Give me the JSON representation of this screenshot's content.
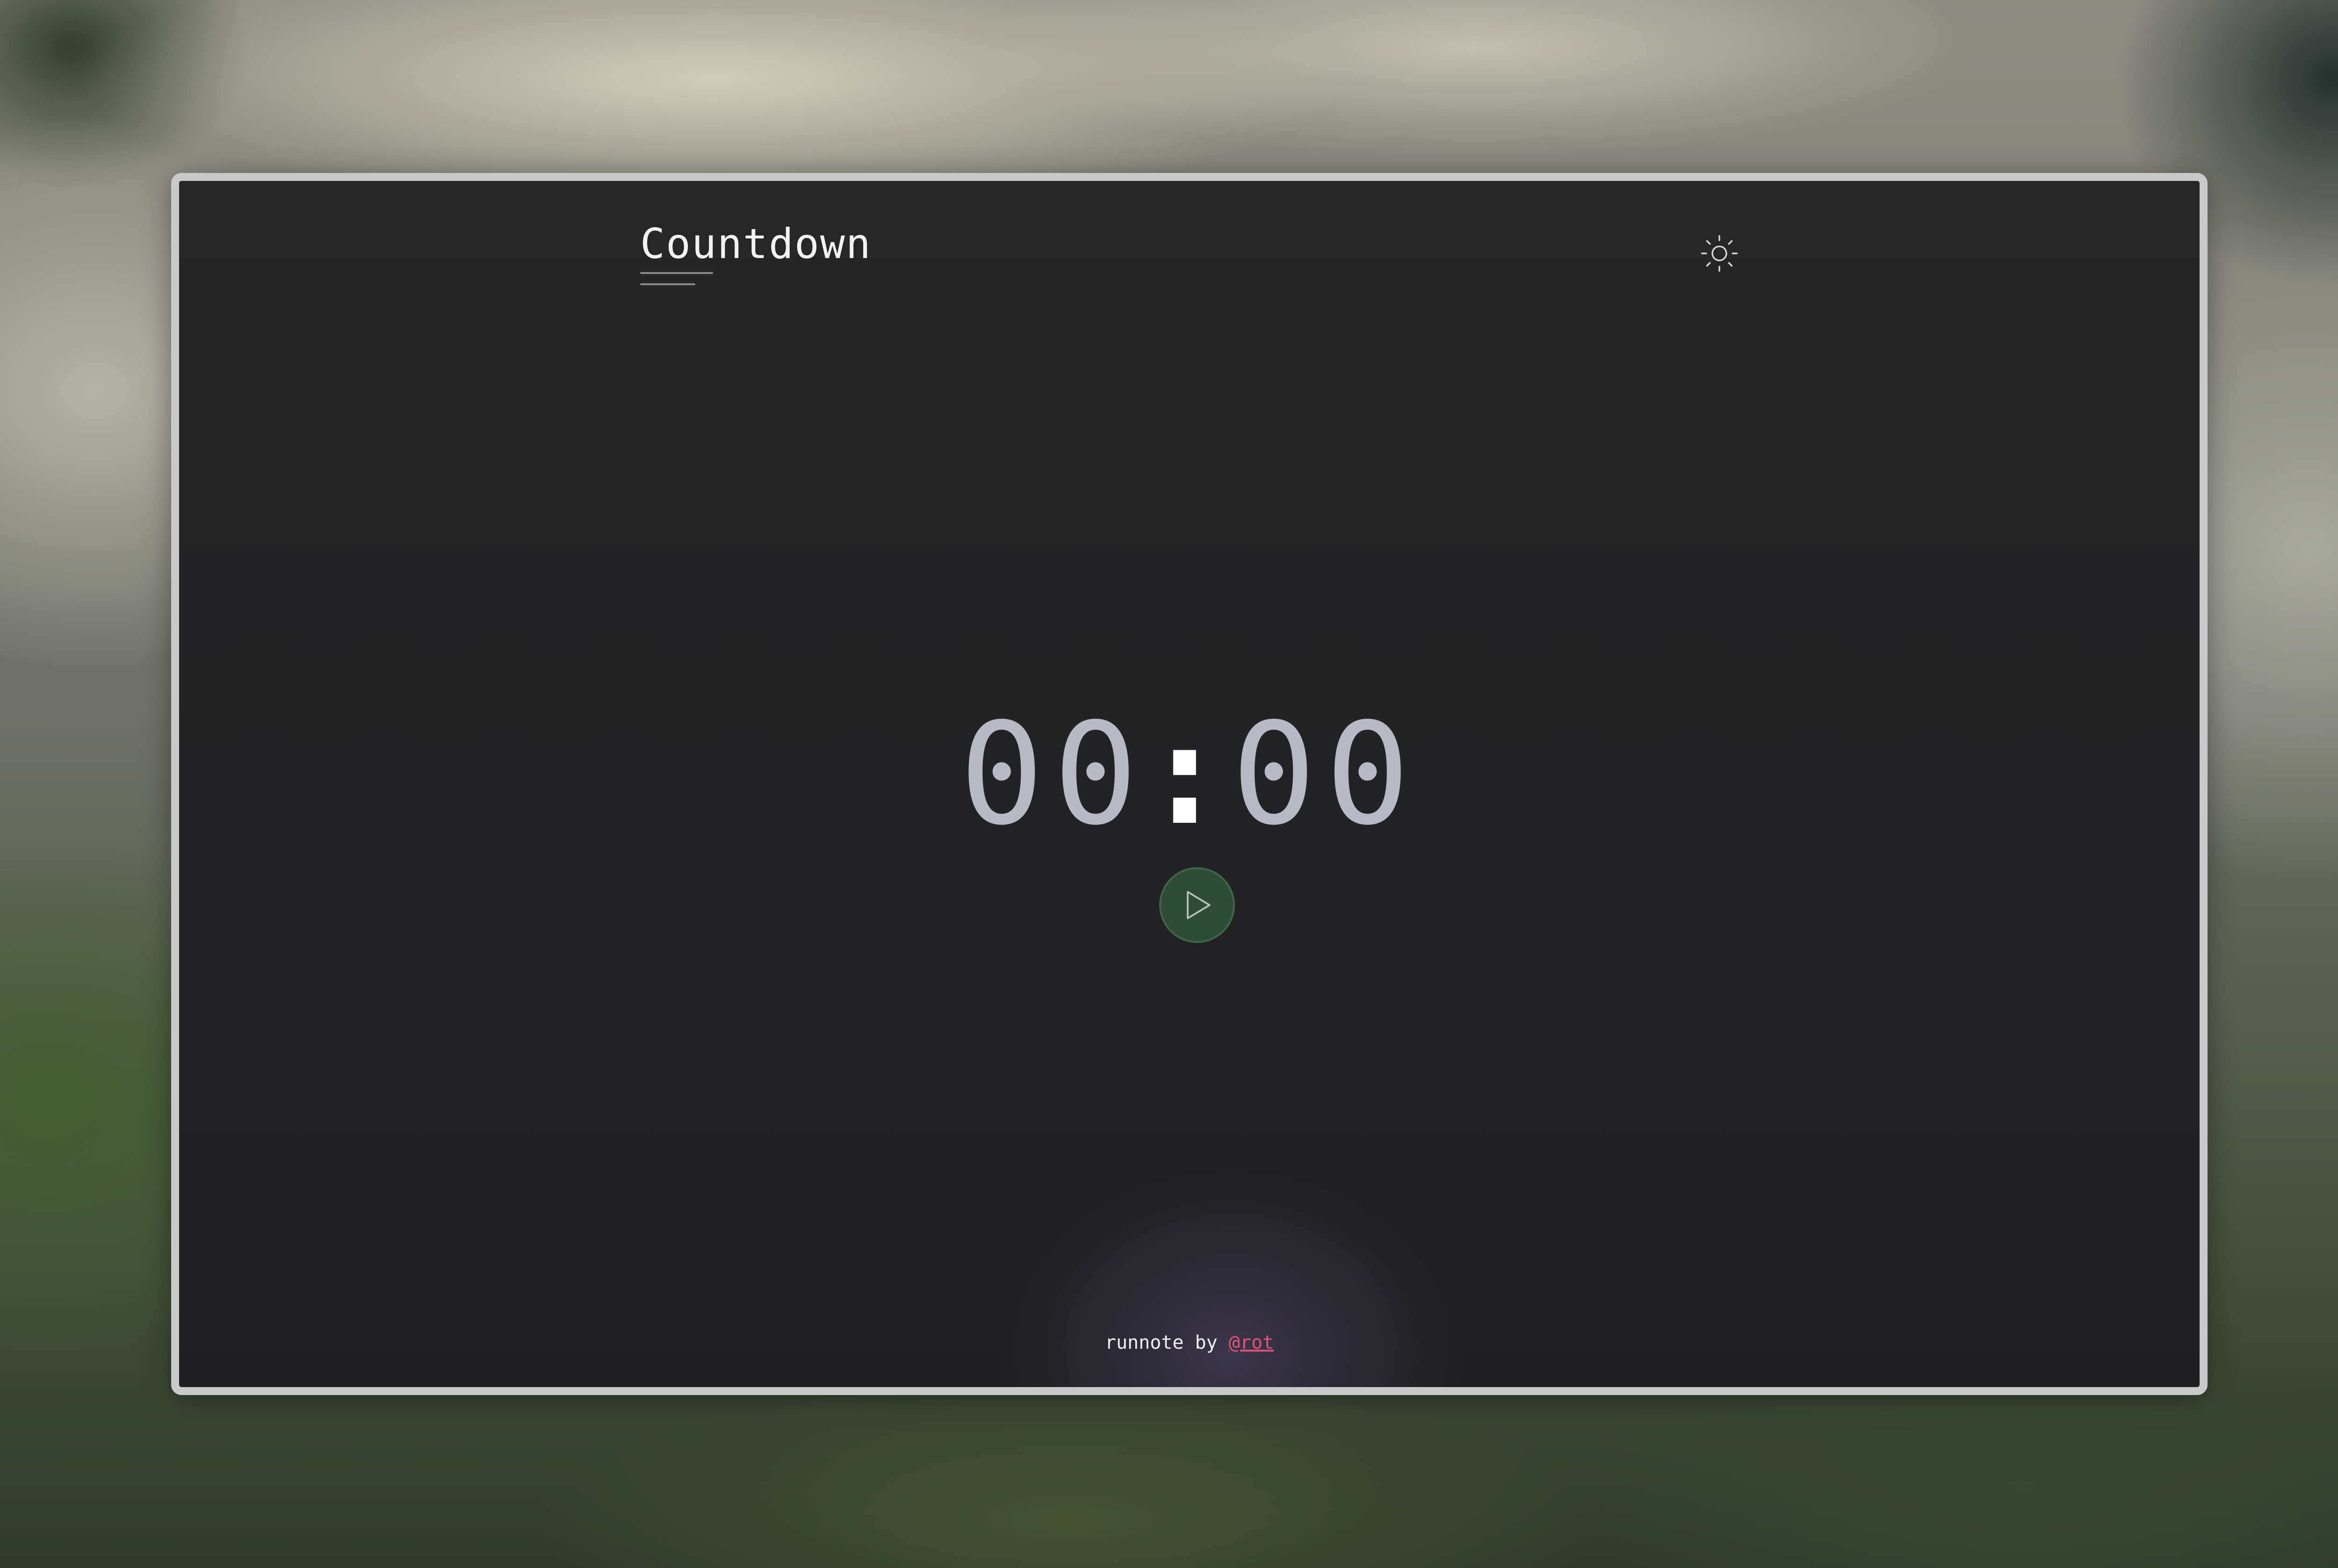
{
  "app": {
    "title": "Countdown"
  },
  "header": {
    "theme_toggle_icon": "sun-icon"
  },
  "timer": {
    "minutes": "00",
    "separator": ":",
    "seconds": "00"
  },
  "controls": {
    "play_icon": "play-icon",
    "play_color": "#2f4c38"
  },
  "footer": {
    "prefix": "runnote by ",
    "author_link": "@rot",
    "link_color": "#e0527a"
  }
}
